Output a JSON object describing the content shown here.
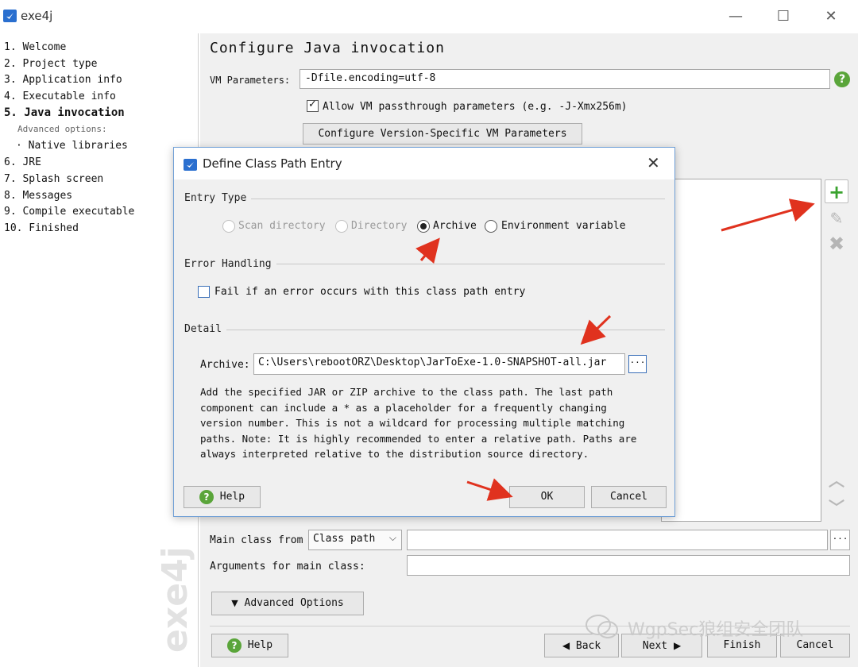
{
  "window": {
    "title": "exe4j",
    "minimize": "—",
    "maximize": "☐",
    "close": "✕"
  },
  "nav": {
    "items": [
      {
        "label": "1. Welcome"
      },
      {
        "label": "2. Project type"
      },
      {
        "label": "3. Application info"
      },
      {
        "label": "4. Executable info"
      },
      {
        "label": "5. Java invocation",
        "active": true
      },
      {
        "label": "Advanced options:"
      },
      {
        "label": "· Native libraries"
      },
      {
        "label": "6. JRE"
      },
      {
        "label": "7. Splash screen"
      },
      {
        "label": "8. Messages"
      },
      {
        "label": "9. Compile executable"
      },
      {
        "label": "10. Finished"
      }
    ],
    "brand_watermark": "exe4j"
  },
  "main": {
    "title": "Configure Java invocation",
    "vm_label": "VM Parameters:",
    "vm_value": "-Dfile.encoding=utf-8",
    "allow_passthrough_label": "Allow VM passthrough parameters (e.g. -J-Xmx256m)",
    "allow_passthrough_checked": true,
    "version_specific_button": "Configure Version-Specific VM Parameters",
    "main_class_from_label": "Main class from",
    "main_class_from_value": "Class path",
    "main_class_value": "",
    "browse_label": "···",
    "arguments_label": "Arguments for main class:",
    "arguments_value": "",
    "advanced_options_button": "Advanced Options",
    "help_button": "Help",
    "back_button": "Back",
    "next_button": "Next",
    "finish_button": "Finish",
    "cancel_button": "Cancel"
  },
  "dialog": {
    "title": "Define Class Path Entry",
    "close": "✕",
    "entry_type_label": "Entry Type",
    "entry_types": [
      {
        "label": "Scan directory",
        "enabled": false,
        "selected": false
      },
      {
        "label": "Directory",
        "enabled": false,
        "selected": false
      },
      {
        "label": "Archive",
        "enabled": true,
        "selected": true
      },
      {
        "label": "Environment variable",
        "enabled": true,
        "selected": false
      }
    ],
    "error_handling_label": "Error Handling",
    "fail_on_error_label": "Fail if an error occurs with this class path entry",
    "fail_on_error_checked": false,
    "detail_label": "Detail",
    "archive_label": "Archive:",
    "archive_value": "C:\\Users\\rebootORZ\\Desktop\\JarToExe-1.0-SNAPSHOT-all.jar",
    "browse_label": "···",
    "description": "Add the specified JAR or ZIP archive to the class path. The last path component can include a * as a placeholder for a frequently changing version number. This is not a wildcard for processing multiple matching paths. Note: It is highly recommended to enter a relative path. Paths are always interpreted relative to the distribution source directory.",
    "help_button": "Help",
    "ok_button": "OK",
    "cancel_button": "Cancel"
  },
  "watermark": {
    "text": "WgpSec狼组安全团队"
  },
  "colors": {
    "dialog_border": "#6f9fd6",
    "help_green": "#5aa53a",
    "arrow_red": "#e0321e",
    "add_green": "#3aa32e"
  }
}
